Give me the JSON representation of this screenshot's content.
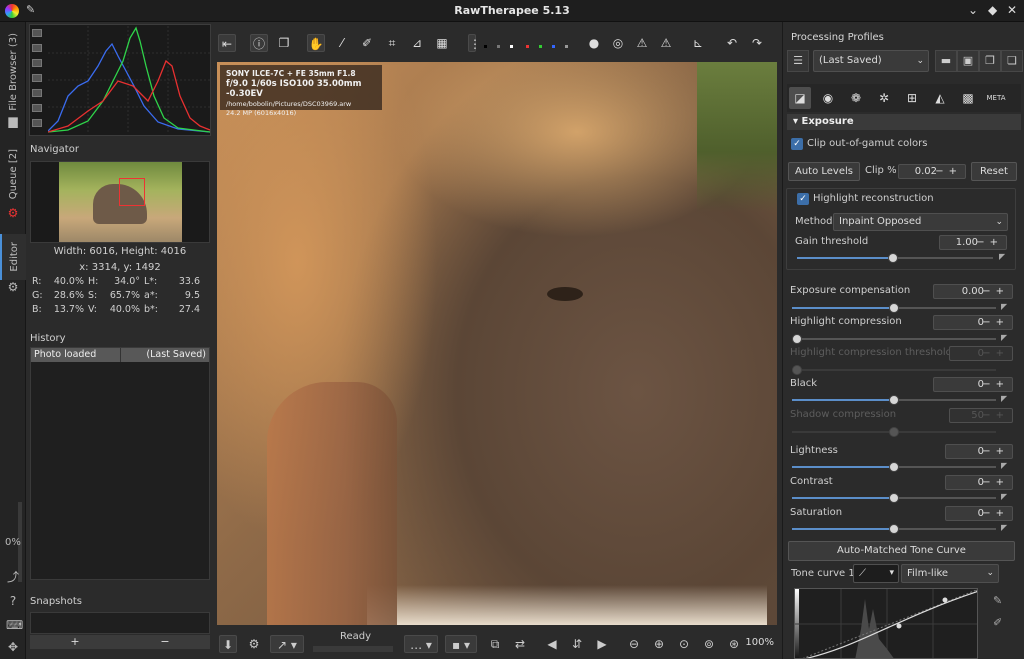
{
  "window": {
    "title": "RawTherapee 5.13"
  },
  "vtabs": {
    "file_browser": "File Browser (3)",
    "queue": "Queue [2]",
    "editor": "Editor",
    "progress": "0%"
  },
  "left": {
    "navigator_title": "Navigator",
    "size_info": "Width: 6016, Height: 4016",
    "coords": "x: 3314, y: 1492",
    "values": [
      [
        "R:",
        "40.0%",
        "H:",
        "34.0°",
        "L*:",
        "33.6"
      ],
      [
        "G:",
        "28.6%",
        "S:",
        "65.7%",
        "a*:",
        "9.5"
      ],
      [
        "B:",
        "13.7%",
        "V:",
        "40.0%",
        "b*:",
        "27.4"
      ]
    ],
    "history_title": "History",
    "history_row": {
      "name": "Photo loaded",
      "profile": "(Last Saved)"
    },
    "snapshots_title": "Snapshots",
    "snap_add": "+",
    "snap_remove": "−"
  },
  "exif": {
    "camera": "SONY ILCE-7C + FE 35mm F1.8",
    "settings": "f/9.0 1/60s ISO100 35.00mm -0.30EV",
    "path": "/home/bobolin/Pictures/DSC03969.arw",
    "megapixels": "24.2 MP (6016x4016)"
  },
  "bottom": {
    "status": "Ready",
    "zoom": "100%"
  },
  "right": {
    "processing_title": "Processing Profiles",
    "profile_value": "(Last Saved)",
    "exposure_title": "Exposure",
    "clip_gamut": "Clip out-of-gamut colors",
    "auto_levels": "Auto Levels",
    "clip_label": "Clip %",
    "clip_value": "0.02",
    "reset": "Reset",
    "highlight_recon": "Highlight reconstruction",
    "method_label": "Method:",
    "method_value": "Inpaint Opposed",
    "gain_label": "Gain threshold",
    "gain_value": "1.00",
    "exp_comp_label": "Exposure compensation",
    "exp_comp_value": "0.00",
    "hl_comp_label": "Highlight compression",
    "hl_comp_value": "0",
    "hl_thresh_label": "Highlight compression threshold",
    "hl_thresh_value": "0",
    "black_label": "Black",
    "black_value": "0",
    "shadow_label": "Shadow compression",
    "shadow_value": "50",
    "lightness_label": "Lightness",
    "lightness_value": "0",
    "contrast_label": "Contrast",
    "contrast_value": "0",
    "saturation_label": "Saturation",
    "saturation_value": "0",
    "amtc": "Auto-Matched Tone Curve",
    "tone_curve_label": "Tone curve 1:",
    "tone_curve_mode": "Film-like"
  },
  "colors": {
    "accent": "#5b8ec9",
    "check": "#3c6ea8"
  }
}
